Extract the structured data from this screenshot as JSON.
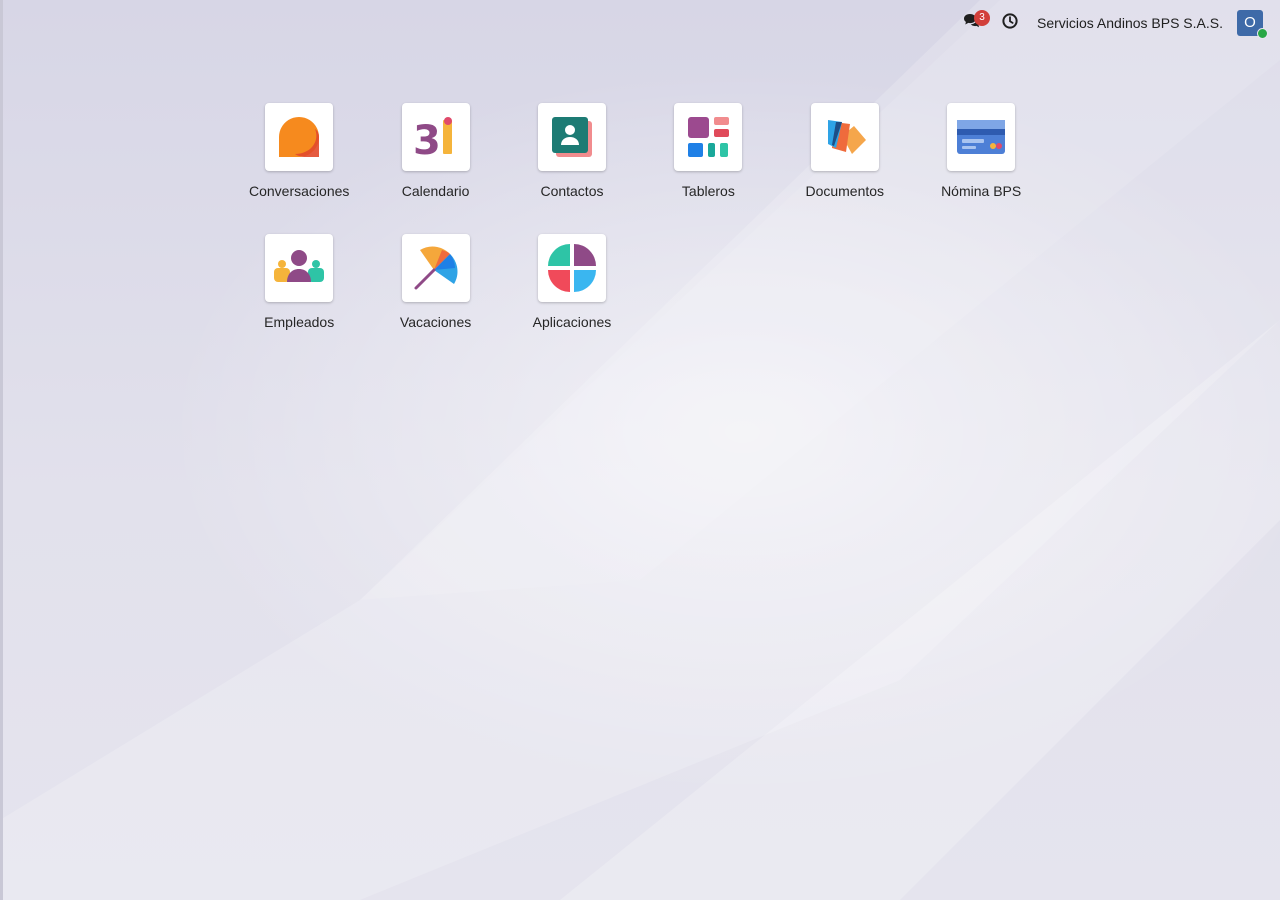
{
  "topbar": {
    "chat_icon": "chat-bubbles-icon",
    "message_count": "3",
    "activity_icon": "clock-icon",
    "company_name": "Servicios Andinos BPS S.A.S.",
    "user_initial": "O",
    "presence_color": "#28a745"
  },
  "apps": [
    {
      "label": "Conversaciones",
      "icon": "conversaciones-icon"
    },
    {
      "label": "Calendario",
      "icon": "calendario-icon"
    },
    {
      "label": "Contactos",
      "icon": "contactos-icon"
    },
    {
      "label": "Tableros",
      "icon": "tableros-icon"
    },
    {
      "label": "Documentos",
      "icon": "documentos-icon"
    },
    {
      "label": "Nómina BPS",
      "icon": "nomina-icon"
    },
    {
      "label": "Empleados",
      "icon": "empleados-icon"
    },
    {
      "label": "Vacaciones",
      "icon": "vacaciones-icon"
    },
    {
      "label": "Aplicaciones",
      "icon": "aplicaciones-icon"
    }
  ],
  "colors": {
    "badge": "#d23f3a",
    "avatar": "#3e6aa8"
  }
}
